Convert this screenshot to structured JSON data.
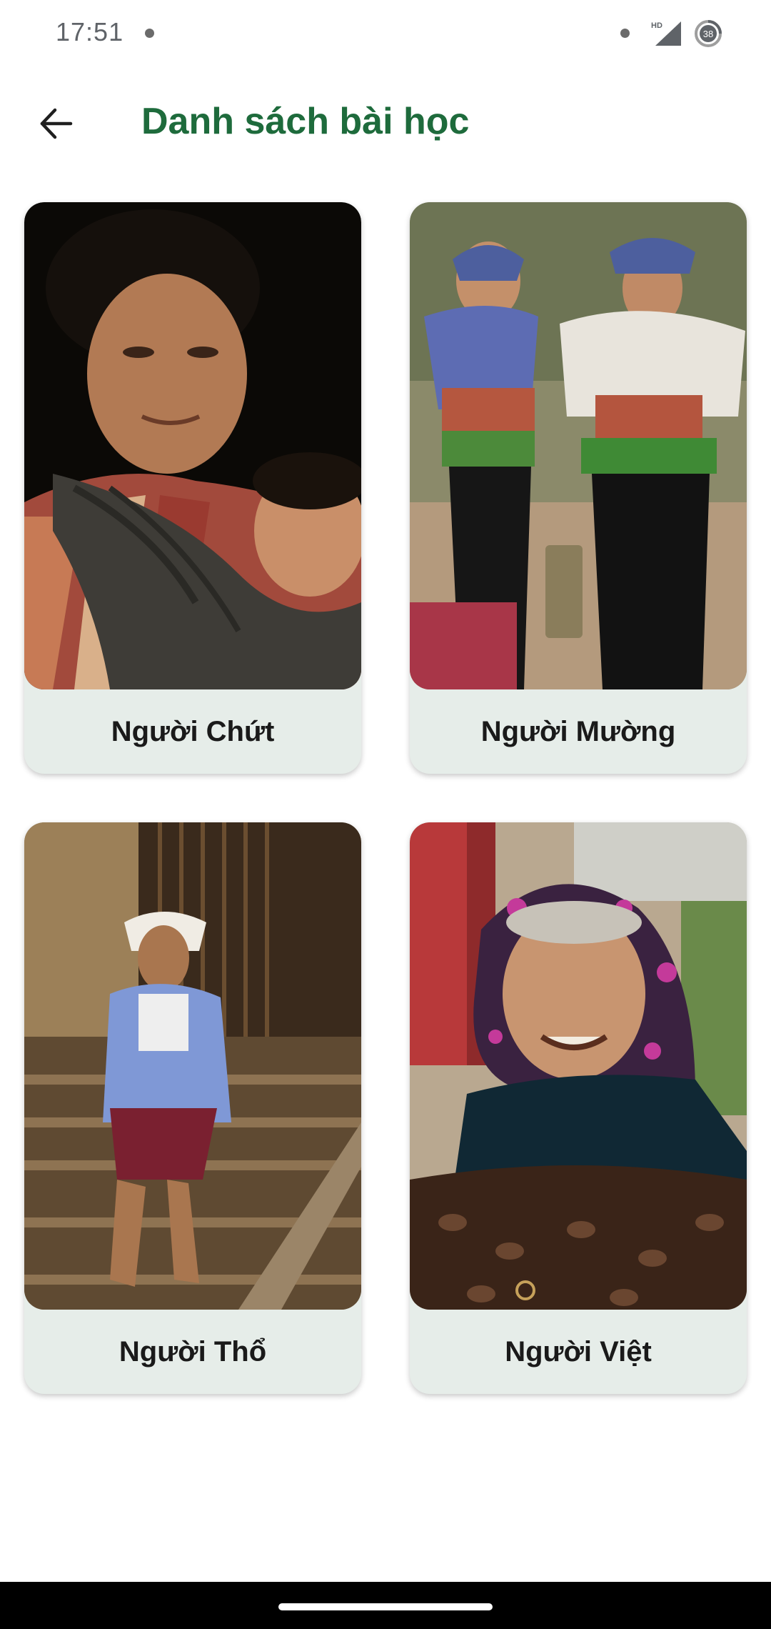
{
  "status_bar": {
    "time": "17:51",
    "network_label": "HD",
    "battery_level": "38"
  },
  "app_bar": {
    "title": "Danh sách bài học",
    "back_icon": "arrow-left-icon"
  },
  "lessons": [
    {
      "label": "Người Chứt"
    },
    {
      "label": "Người Mường"
    },
    {
      "label": "Người Thổ"
    },
    {
      "label": "Người Việt"
    }
  ],
  "colors": {
    "title_green": "#1e6b3c",
    "card_background": "#e6ede9",
    "nav_bar": "#000000"
  }
}
